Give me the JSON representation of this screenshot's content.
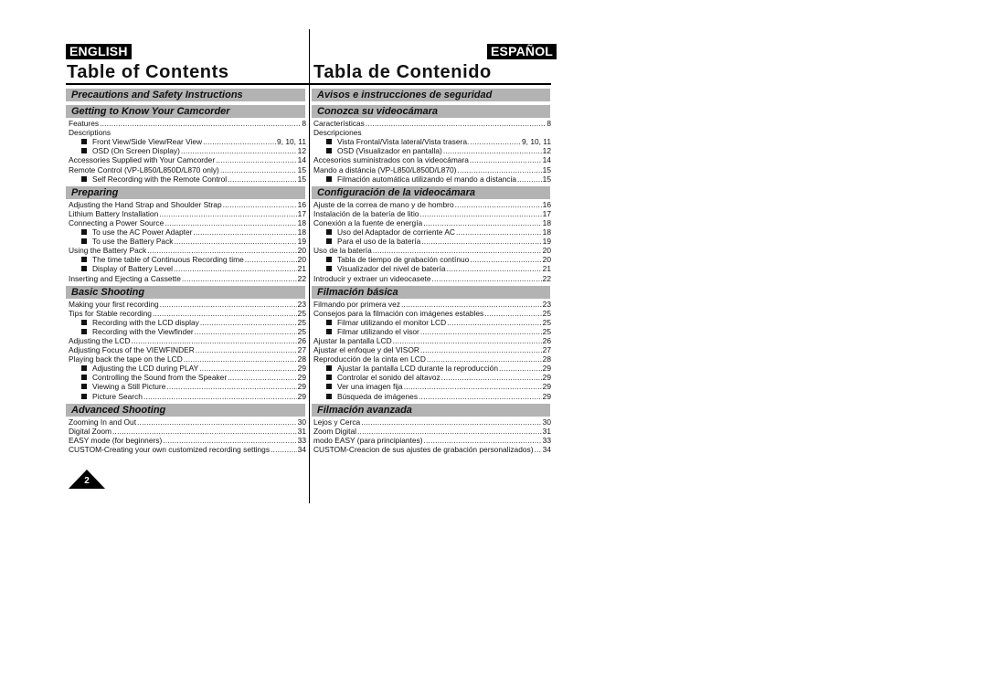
{
  "header": {
    "lang_en": "ENGLISH",
    "lang_es": "ESPAÑOL",
    "title_en": "Table of Contents",
    "title_es": "Tabla de Contenido"
  },
  "page_number": "2",
  "english": {
    "sections": [
      {
        "title": "Precautions and Safety Instructions",
        "entries": []
      },
      {
        "title": "Getting to Know Your Camcorder",
        "entries": [
          {
            "label": "Features",
            "page": "8",
            "sub": false
          },
          {
            "label": "Descriptions",
            "page": "",
            "sub": false
          },
          {
            "label": "Front View/Side View/Rear View",
            "page": "9, 10, 11",
            "sub": true
          },
          {
            "label": "OSD (On Screen Display)",
            "page": "12",
            "sub": true
          },
          {
            "label": "Accessories Supplied with Your Camcorder",
            "page": "14",
            "sub": false
          },
          {
            "label": "Remote Control (VP-L850/L850D/L870 only)",
            "page": "15",
            "sub": false
          },
          {
            "label": "Self Recording with the Remote Control",
            "page": "15",
            "sub": true
          }
        ]
      },
      {
        "title": "Preparing",
        "entries": [
          {
            "label": "Adjusting the Hand Strap and Shoulder Strap",
            "page": "16",
            "sub": false
          },
          {
            "label": "Lithium Battery Installation",
            "page": "17",
            "sub": false
          },
          {
            "label": "Connecting a Power Source",
            "page": "18",
            "sub": false
          },
          {
            "label": "To use the AC Power Adapter",
            "page": "18",
            "sub": true
          },
          {
            "label": "To use the Battery Pack",
            "page": "19",
            "sub": true
          },
          {
            "label": "Using the Battery Pack",
            "page": "20",
            "sub": false
          },
          {
            "label": "The time table of Continuous Recording time",
            "page": "20",
            "sub": true
          },
          {
            "label": "Display of Battery Level",
            "page": "21",
            "sub": true
          },
          {
            "label": "Inserting and Ejecting a Cassette",
            "page": "22",
            "sub": false
          }
        ]
      },
      {
        "title": "Basic Shooting",
        "entries": [
          {
            "label": "Making your first recording",
            "page": "23",
            "sub": false
          },
          {
            "label": "Tips for Stable recording",
            "page": "25",
            "sub": false
          },
          {
            "label": "Recording with the LCD display",
            "page": "25",
            "sub": true
          },
          {
            "label": "Recording with the Viewfinder",
            "page": "25",
            "sub": true
          },
          {
            "label": "Adjusting the LCD",
            "page": "26",
            "sub": false
          },
          {
            "label": "Adjusting Focus of the VIEWFINDER",
            "page": "27",
            "sub": false
          },
          {
            "label": "Playing back the tape on the LCD",
            "page": "28",
            "sub": false
          },
          {
            "label": "Adjusting the LCD during PLAY",
            "page": "29",
            "sub": true
          },
          {
            "label": "Controlling the Sound from the Speaker",
            "page": "29",
            "sub": true
          },
          {
            "label": "Viewing a Still Picture",
            "page": "29",
            "sub": true
          },
          {
            "label": "Picture Search",
            "page": "29",
            "sub": true
          }
        ]
      },
      {
        "title": "Advanced Shooting",
        "entries": [
          {
            "label": "Zooming In and Out",
            "page": "30",
            "sub": false
          },
          {
            "label": "Digital Zoom",
            "page": "31",
            "sub": false
          },
          {
            "label": "EASY mode (for beginners)",
            "page": "33",
            "sub": false
          },
          {
            "label": "CUSTOM-Creating your own customized recording settings",
            "page": "34",
            "sub": false
          }
        ]
      }
    ]
  },
  "spanish": {
    "sections": [
      {
        "title": "Avisos e instrucciones de seguridad",
        "entries": []
      },
      {
        "title": "Conozca su videocámara",
        "entries": [
          {
            "label": "Características",
            "page": "8",
            "sub": false
          },
          {
            "label": "Descripciones",
            "page": "",
            "sub": false
          },
          {
            "label": "Vista Frontal/Vista lateral/Vista trasera.",
            "page": "9, 10, 11",
            "sub": true
          },
          {
            "label": "OSD (Visualizador en pantalla)",
            "page": "12",
            "sub": true
          },
          {
            "label": "Accesorios suministrados con la videocámara",
            "page": "14",
            "sub": false
          },
          {
            "label": "Mando a distáncia (VP-L850/L850D/L870)",
            "page": "15",
            "sub": false
          },
          {
            "label": "Filmación automática utilizando el mando a distancia",
            "page": "15",
            "sub": true
          }
        ]
      },
      {
        "title": "Configuración de la videocámara",
        "entries": [
          {
            "label": "Ajuste de la correa de mano y de hombro",
            "page": "16",
            "sub": false
          },
          {
            "label": "Instalación de la batería de litio",
            "page": "17",
            "sub": false
          },
          {
            "label": "Conexión a la fuente de energía",
            "page": "18",
            "sub": false
          },
          {
            "label": "Uso del Adaptador de corriente AC",
            "page": "18",
            "sub": true
          },
          {
            "label": "Para el uso de la batería",
            "page": "19",
            "sub": true
          },
          {
            "label": "Uso de la batería",
            "page": "20",
            "sub": false
          },
          {
            "label": "Tabla de tiempo de grabación contínuo",
            "page": "20",
            "sub": true
          },
          {
            "label": "Visualizador del nivel de batería",
            "page": "21",
            "sub": true
          },
          {
            "label": "Introducir y extraer un videocasete",
            "page": "22",
            "sub": false
          }
        ]
      },
      {
        "title": "Filmación básica",
        "entries": [
          {
            "label": "Filmando por primera vez",
            "page": "23",
            "sub": false
          },
          {
            "label": "Consejos para la filmación con imágenes estables",
            "page": "25",
            "sub": false
          },
          {
            "label": "Filmar utilizando el monitor LCD",
            "page": "25",
            "sub": true
          },
          {
            "label": "Filmar utilizando el visor",
            "page": "25",
            "sub": true
          },
          {
            "label": "Ajustar la pantalla LCD",
            "page": "26",
            "sub": false
          },
          {
            "label": "Ajustar el enfoque y del VISOR",
            "page": "27",
            "sub": false
          },
          {
            "label": "Reproducción de la cinta en LCD",
            "page": "28",
            "sub": false
          },
          {
            "label": "Ajustar la pantalla LCD durante la reproducción",
            "page": "29",
            "sub": true
          },
          {
            "label": "Controlar el sonido del altavoz",
            "page": "29",
            "sub": true
          },
          {
            "label": "Ver una imagen fija",
            "page": "29",
            "sub": true
          },
          {
            "label": "Búsqueda de imágenes",
            "page": "29",
            "sub": true
          }
        ]
      },
      {
        "title": "Filmación avanzada",
        "entries": [
          {
            "label": "Lejos y Cerca",
            "page": "30",
            "sub": false
          },
          {
            "label": "Zoom Digital",
            "page": "31",
            "sub": false
          },
          {
            "label": "modo EASY (para principiantes)",
            "page": "33",
            "sub": false
          },
          {
            "label": "CUSTOM-Creacion de sus ajustes de grabación personalizados)",
            "page": "34",
            "sub": false
          }
        ]
      }
    ]
  }
}
